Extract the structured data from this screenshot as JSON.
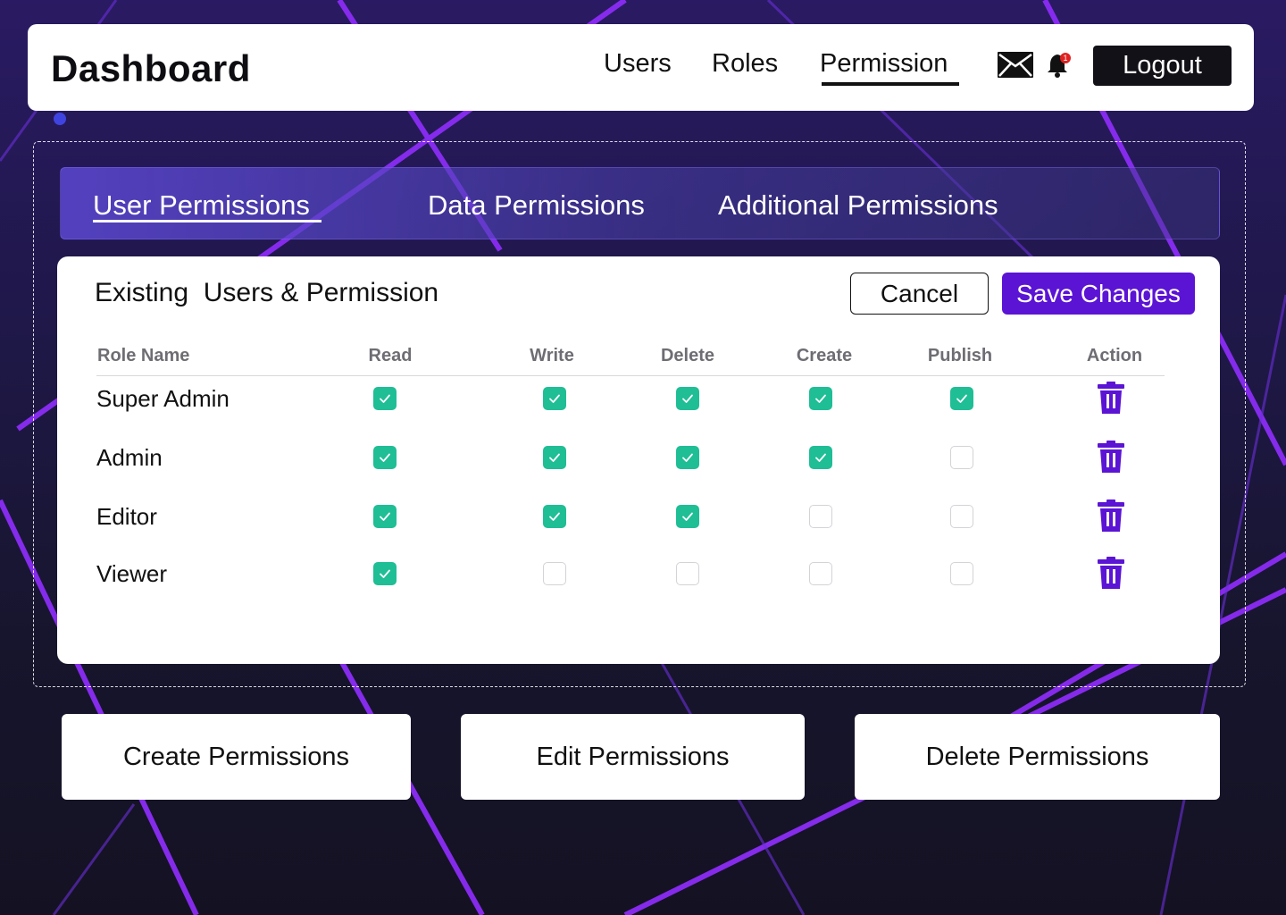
{
  "header": {
    "brand": "Dashboard",
    "nav": [
      "Users",
      "Roles",
      "Permission"
    ],
    "active_nav": "Permission",
    "mail_icon": "mail-icon",
    "bell_icon": "bell-icon",
    "notification_count": "1",
    "logout_label": "Logout"
  },
  "tabs": {
    "items": [
      "User Permissions",
      "Data Permissions",
      "Additional Permissions"
    ],
    "active": "User Permissions"
  },
  "card": {
    "title": "Existing  Users & Permission",
    "cancel_label": "Cancel",
    "save_label": "Save Changes",
    "columns": [
      "Role Name",
      "Read",
      "Write",
      "Delete",
      "Create",
      "Publish",
      "Action"
    ],
    "rows": [
      {
        "role": "Super Admin",
        "perms": [
          true,
          true,
          true,
          true,
          true
        ]
      },
      {
        "role": "Admin",
        "perms": [
          true,
          true,
          true,
          true,
          false
        ]
      },
      {
        "role": "Editor",
        "perms": [
          true,
          true,
          true,
          false,
          false
        ]
      },
      {
        "role": "Viewer",
        "perms": [
          true,
          false,
          false,
          false,
          false
        ]
      }
    ],
    "action_icon": "trash-icon"
  },
  "bottom_buttons": [
    "Create Permissions",
    "Edit Permissions",
    "Delete Permissions"
  ],
  "colors": {
    "accent": "#5b14d4",
    "checkbox_on": "#1fbe95",
    "trash": "#5b14d4",
    "notification_badge": "#e02020"
  }
}
